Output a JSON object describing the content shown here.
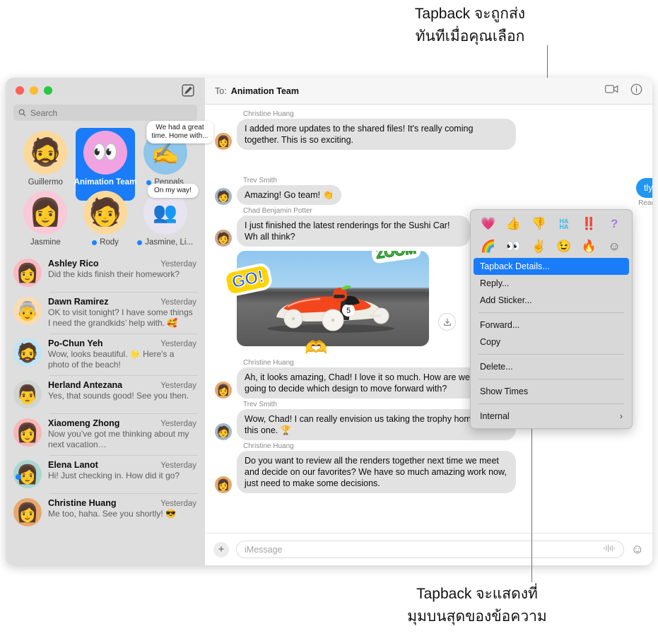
{
  "annotations": {
    "top": "Tapback จะถูกส่ง\nทันทีเมื่อคุณเลือก",
    "top_line1": "Tapback จะถูกส่ง",
    "top_line2": "ทันทีเมื่อคุณเลือก",
    "bottom_line1": "Tapback จะแสดงที่",
    "bottom_line2": "มุมบนสุดของข้อความ"
  },
  "window": {
    "traffic_lights": [
      "close",
      "minimize",
      "zoom"
    ],
    "compose_icon": "compose-icon"
  },
  "sidebar": {
    "search": {
      "placeholder": "Search",
      "icon": "search-icon"
    },
    "pinned": [
      {
        "name": "Guillermo",
        "glyph": "🧔",
        "bg": "#fbd99a",
        "unread": false,
        "selected": false,
        "bubble": null
      },
      {
        "name": "Animation Team",
        "glyph": "👀",
        "bg": "#f0a3e0",
        "unread": false,
        "selected": true,
        "bubble": null
      },
      {
        "name": "Penpals",
        "glyph": "✍️",
        "bg": "#8ec5ea",
        "unread": true,
        "selected": false,
        "bubble": "We had a great time. Home with..."
      },
      {
        "name": "Jasmine",
        "glyph": "👩",
        "bg": "#f8c9d8",
        "unread": false,
        "selected": false,
        "bubble": null
      },
      {
        "name": "Rody",
        "glyph": "🧑",
        "bg": "#fbd99a",
        "unread": true,
        "selected": false,
        "bubble": null
      },
      {
        "name": "Jasmine, Li...",
        "glyph": "👥",
        "bg": "#e7e3ef",
        "unread": true,
        "selected": false,
        "bubble": "On my way!"
      }
    ],
    "conversations": [
      {
        "name": "Ashley Rico",
        "time": "Yesterday",
        "preview": "Did the kids finish their homework?",
        "unread": false,
        "glyph": "👩",
        "bg": "#f9b9c0"
      },
      {
        "name": "Dawn Ramirez",
        "time": "Yesterday",
        "preview": "OK to visit tonight? I have some things I need the grandkids’ help with. 🥰",
        "unread": false,
        "glyph": "👵",
        "bg": "#fbdcb0"
      },
      {
        "name": "Po-Chun Yeh",
        "time": "Yesterday",
        "preview": "Wow, looks beautiful. 🌟 Here's a photo of the beach!",
        "unread": false,
        "glyph": "🧔",
        "bg": "#bde5f5"
      },
      {
        "name": "Herland Antezana",
        "time": "Yesterday",
        "preview": "Yes, that sounds good! See you then.",
        "unread": false,
        "glyph": "👨",
        "bg": "#cfd6d0"
      },
      {
        "name": "Xiaomeng Zhong",
        "time": "Yesterday",
        "preview": "Now you’ve got me thinking about my next vacation…",
        "unread": false,
        "glyph": "👩",
        "bg": "#f9b6b6"
      },
      {
        "name": "Elena Lanot",
        "time": "Yesterday",
        "preview": "Hi! Just checking in. How did it go?",
        "unread": true,
        "glyph": "👩",
        "bg": "#a9d6d0"
      },
      {
        "name": "Christine Huang",
        "time": "Yesterday",
        "preview": "Me too, haha. See you shortly! 😎",
        "unread": false,
        "glyph": "👩",
        "bg": "#e8a86a"
      }
    ]
  },
  "chat": {
    "to_label": "To:",
    "to_value": "Animation Team",
    "header_icons": [
      "video-call-icon",
      "info-icon"
    ],
    "messages": [
      {
        "sender": "Christine Huang",
        "text": "I added more updates to the shared files! It's really coming together. This is so exciting.",
        "side": "in",
        "glyph": "👩",
        "bg": "#e8a86a"
      },
      {
        "sender": "Trev Smith",
        "text": "Amazing! Go team! 👏",
        "side": "in",
        "glyph": "🧑",
        "bg": "#9fb8c9"
      },
      {
        "sender": "Chad Benjamin Potter",
        "text": "I just finished the latest renderings for the Sushi Car! Wh                 all think?",
        "side": "in",
        "glyph": "🧑",
        "bg": "#c9a88a"
      },
      {
        "sender": "Christine Huang",
        "text": "Ah, it looks amazing, Chad! I love it so much. How are we ever going to decide which design to move forward with?",
        "side": "in",
        "glyph": "👩",
        "bg": "#e8a86a",
        "tapback": "🌈"
      },
      {
        "sender": "Trev Smith",
        "text": "Wow, Chad! I can really envision us taking the trophy home with this one. 🏆",
        "side": "in",
        "glyph": "🧑",
        "bg": "#9fb8c9"
      },
      {
        "sender": "Christine Huang",
        "text": "Do you want to review all the renders together next time we meet and decide on our favorites? We have so much amazing work now, just need to make some decisions.",
        "side": "in",
        "glyph": "👩",
        "bg": "#e8a86a"
      }
    ],
    "outgoing_partial": {
      "text": "tly.",
      "status": "Read"
    },
    "image_message": {
      "stickers": [
        {
          "name": "go-sticker",
          "text": "GO!"
        },
        {
          "name": "zoom-sticker",
          "text": "ZOOM"
        },
        {
          "name": "heart-hands-sticker",
          "text": "🫶"
        }
      ],
      "download_icon": "download-icon",
      "alt": "Red and white soap box derby car number 5 racing on a track"
    },
    "compose": {
      "plus_icon": "plus-icon",
      "placeholder": "iMessage",
      "audio_icon": "audio-waveform-icon",
      "emoji_icon": "emoji-picker-icon"
    }
  },
  "context_menu": {
    "tapbacks_row1": [
      {
        "name": "heart-tapback",
        "glyph": "💗"
      },
      {
        "name": "thumbs-up-tapback",
        "glyph": "👍"
      },
      {
        "name": "thumbs-down-tapback",
        "glyph": "👎"
      },
      {
        "name": "haha-tapback",
        "text": "HA\nHA"
      },
      {
        "name": "exclamation-tapback",
        "glyph": "‼️"
      },
      {
        "name": "question-tapback",
        "text": "?"
      }
    ],
    "tapbacks_row2": [
      {
        "name": "rainbow-tapback",
        "glyph": "🌈"
      },
      {
        "name": "eyes-tapback",
        "glyph": "👀"
      },
      {
        "name": "peace-tapback",
        "glyph": "✌️"
      },
      {
        "name": "wink-tapback",
        "glyph": "😉"
      },
      {
        "name": "fire-tapback",
        "glyph": "🔥"
      },
      {
        "name": "more-emoji-tapback",
        "glyph": "☺"
      }
    ],
    "items": [
      {
        "label": "Tapback Details...",
        "highlighted": true,
        "submenu": false
      },
      {
        "label": "Reply...",
        "highlighted": false,
        "submenu": false
      },
      {
        "label": "Add Sticker...",
        "highlighted": false,
        "submenu": false
      },
      {
        "label": "Forward...",
        "highlighted": false,
        "submenu": false
      },
      {
        "label": "Copy",
        "highlighted": false,
        "submenu": false
      },
      {
        "label": "Delete...",
        "highlighted": false,
        "submenu": false
      },
      {
        "label": "Show Times",
        "highlighted": false,
        "submenu": false
      },
      {
        "label": "Internal",
        "highlighted": false,
        "submenu": true
      }
    ],
    "separators_after": [
      2,
      4,
      5,
      6
    ],
    "chevron": "›"
  },
  "colors": {
    "accent_blue": "#1a7cf8",
    "bubble_gray": "#e2e2e2",
    "bubble_blue": "#2196f3",
    "sidebar_bg": "#dedede",
    "unread_dot": "#1a84ff"
  }
}
